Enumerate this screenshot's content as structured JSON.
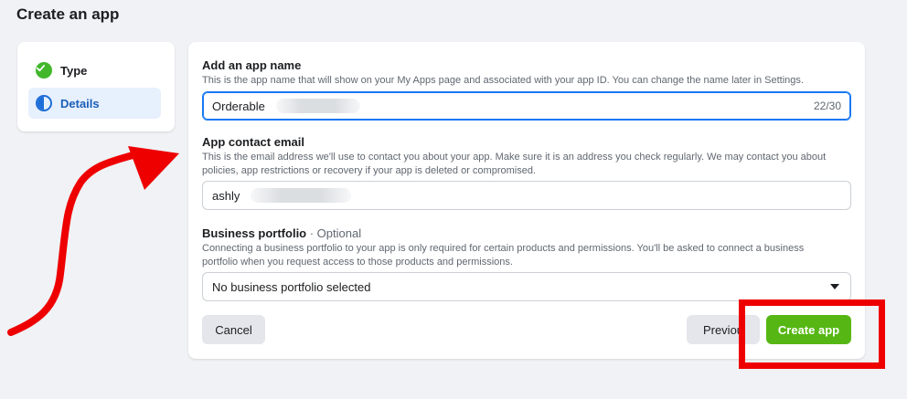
{
  "page": {
    "title": "Create an app"
  },
  "steps": [
    {
      "label": "Type",
      "icon": "check-circle-icon",
      "state": "complete"
    },
    {
      "label": "Details",
      "icon": "half-circle-icon",
      "state": "active"
    }
  ],
  "form": {
    "app_name": {
      "label": "Add an app name",
      "help": "This is the app name that will show on your My Apps page and associated with your app ID. You can change the name later in Settings.",
      "value": "Orderable",
      "counter": "22/30"
    },
    "contact_email": {
      "label": "App contact email",
      "help": "This is the email address we'll use to contact you about your app. Make sure it is an address you check regularly. We may contact you about policies, app restrictions or recovery if your app is deleted or compromised.",
      "value": "ashly"
    },
    "business_portfolio": {
      "label": "Business portfolio",
      "optional": " · Optional",
      "help": "Connecting a business portfolio to your app is only required for certain products and permissions. You'll be asked to connect a business portfolio when you request access to those products and permissions.",
      "selected": "No business portfolio selected"
    }
  },
  "buttons": {
    "cancel": "Cancel",
    "previous": "Previou",
    "create": "Create app"
  },
  "colors": {
    "accent": "#1877f2",
    "create_button": "#56b714",
    "annotation": "#ee0000"
  }
}
